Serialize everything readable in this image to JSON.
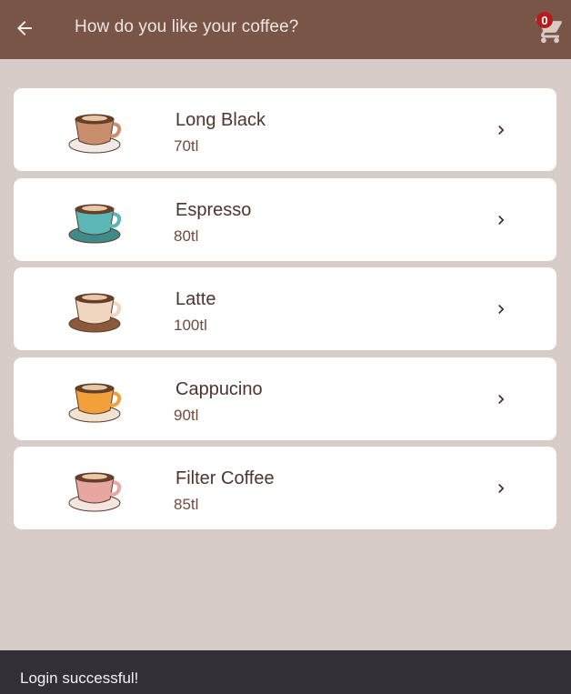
{
  "appbar": {
    "title": "How do you like your coffee?",
    "back_icon": "arrow-left-icon",
    "cart_icon": "shopping-cart-icon",
    "cart_count": "0"
  },
  "coffees": [
    {
      "name": "Long Black",
      "price": "70tl",
      "icon": "cup-beige-saucer",
      "cup": "#c98e6b",
      "saucer": "#f1e9e4"
    },
    {
      "name": "Espresso",
      "price": "80tl",
      "icon": "cup-teal",
      "cup": "#5bb7b5",
      "saucer": "#3f8a8a"
    },
    {
      "name": "Latte",
      "price": "100tl",
      "icon": "cup-cream",
      "cup": "#f1d6bf",
      "saucer": "#8a5a3a"
    },
    {
      "name": "Cappucino",
      "price": "90tl",
      "icon": "cup-orange",
      "cup": "#f2a03a",
      "saucer": "#f0e3cf"
    },
    {
      "name": "Filter Coffee",
      "price": "85tl",
      "icon": "cup-pink",
      "cup": "#e8a6a0",
      "saucer": "#f3e6e1"
    }
  ],
  "chevron_icon": "chevron-right-icon",
  "snackbar": {
    "message": "Login successful!"
  },
  "colors": {
    "appbar": "#795548",
    "background": "#d7ccc8",
    "badge": "#b71c1c"
  }
}
